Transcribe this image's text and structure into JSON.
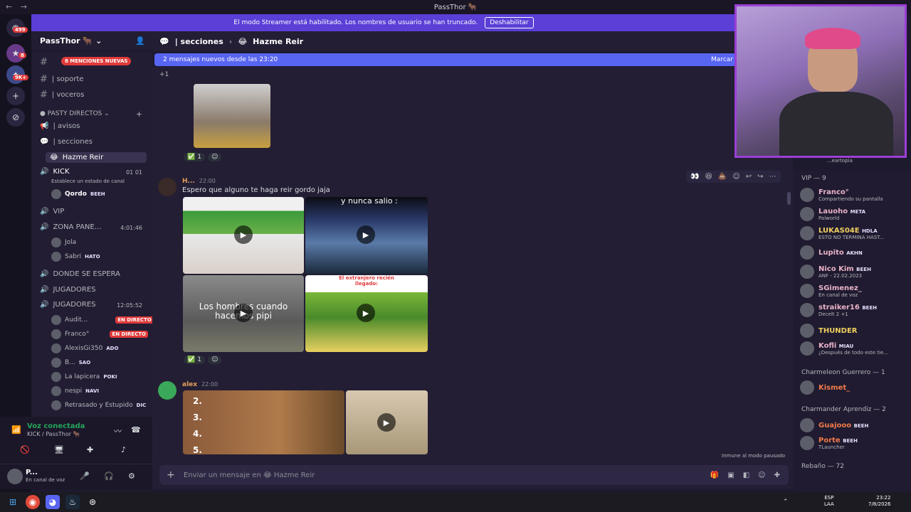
{
  "titlebar": {
    "title": "PassThor 🐂"
  },
  "banner": {
    "text": "El modo Streamer está habilitado. Los nombres de usuario se han truncado.",
    "button": "Deshabilitar"
  },
  "rail": {
    "badge_top": "499",
    "badge_2": "8",
    "badge_3": "9K+"
  },
  "server": {
    "name": "PassThor 🐂"
  },
  "sidebar": {
    "mentions": "8 MENCIONES NUEVAS",
    "channels": [
      {
        "label": "| soporte"
      },
      {
        "label": "| voceros"
      }
    ],
    "category": "PASTY DIRECTOS",
    "channels2": [
      {
        "label": "| avisos"
      },
      {
        "label": "| secciones"
      },
      {
        "label": "Hazme Reir"
      }
    ],
    "kick": {
      "label": "KICK",
      "counts": "01  01",
      "status": "Establece un estado de canal",
      "member": "Qordo",
      "member_tag": "BEEH"
    },
    "vip": "VIP",
    "zona": {
      "label": "ZONA PANE...",
      "time": "4:01:46",
      "members": [
        {
          "name": "Jola",
          "tag": ""
        },
        {
          "name": "Sabri",
          "tag": "HATO"
        }
      ]
    },
    "donde": "DONDE SE ESPERA",
    "jugadores1": "JUGADORES",
    "jugadores2": {
      "label": "JUGADORES",
      "time": "12:05:52"
    },
    "players": [
      {
        "name": "Audit...",
        "tag": "EN DIRECTO"
      },
      {
        "name": "Franco°",
        "tag": "EN DIRECTO"
      },
      {
        "name": "AlexisGi350",
        "tag": "ADO"
      },
      {
        "name": "B...",
        "tag": "SAO"
      },
      {
        "name": "La lapicera",
        "tag": "POKI"
      },
      {
        "name": "nespi",
        "tag": "NAVI"
      },
      {
        "name": "Retrasado y Estupido",
        "tag": "DIC"
      }
    ]
  },
  "voice": {
    "status": "Voz conectada",
    "channel": "KICK / PassThor 🐂"
  },
  "user": {
    "name": "P...",
    "status": "En canal de voz"
  },
  "header": {
    "path": "| secciones",
    "channel": "Hazme Reir",
    "new_messages": "2 mensajes nuevos desde las 23:20",
    "mark": "Marcar"
  },
  "chat": {
    "plus_one": "+1",
    "reaction_1": "1",
    "msg2": {
      "author": "H...",
      "time": "22:00",
      "text": "Espero que alguno te haga reir gordo jaja"
    },
    "captions": {
      "img2": "y nunca salio :",
      "img3": "Los hombres cuando hacemos pipi",
      "img4": "El extranjero recién llegado:"
    },
    "reaction_2": "1",
    "msg3": {
      "author": "alex",
      "time": "22:00"
    },
    "list_numbers": [
      "2.",
      "3.",
      "4.",
      "5."
    ],
    "immune": "Inmune al modo pausado"
  },
  "input": {
    "placeholder": "Enviar un mensaje en 😂 Hazme Reir"
  },
  "members": {
    "vip_head": "VIP — 9",
    "vip": [
      {
        "name": "Franco°",
        "sub": "Compartiendo su pantalla"
      },
      {
        "name": "Lauoho",
        "sub": "Palworld",
        "tag": "META"
      },
      {
        "name": "LUKAS04E",
        "sub": "ESTO NO TERMINA HAST...",
        "tag": "HDLA"
      },
      {
        "name": "Lupito",
        "sub": "",
        "tag": "AKHN"
      },
      {
        "name": "Nico Kim",
        "sub": "ANF - 22.02.2023",
        "tag": "BEEH"
      },
      {
        "name": "SGimenez_",
        "sub": "En canal de voz"
      },
      {
        "name": "straiker16",
        "sub": "Decelt 2 +1",
        "tag": "BEEH"
      },
      {
        "name": "THUNDER",
        "sub": ""
      },
      {
        "name": "Kofli",
        "sub": "¿Después de todo este tie...",
        "tag": "MIAU"
      }
    ],
    "charmeleon_head": "Charmeleon Guerrero — 1",
    "charmeleon": [
      {
        "name": "Kismet_"
      }
    ],
    "charmander_head": "Charmander Aprendiz — 2",
    "charmander": [
      {
        "name": "Guajooo",
        "tag": "BEEH"
      },
      {
        "name": "Porte",
        "tag": "BEEH",
        "sub": "TLauncher"
      }
    ],
    "rebano_head": "Rebaño — 72",
    "heartopia": "...eartopia"
  },
  "taskbar": {
    "lang": "ESP",
    "region": "LAA",
    "time": "23:22",
    "date": "7/8/2026"
  },
  "colors": {
    "accent": "#5865f2",
    "banner": "#5b3fd6",
    "live": "#e03a3a"
  }
}
